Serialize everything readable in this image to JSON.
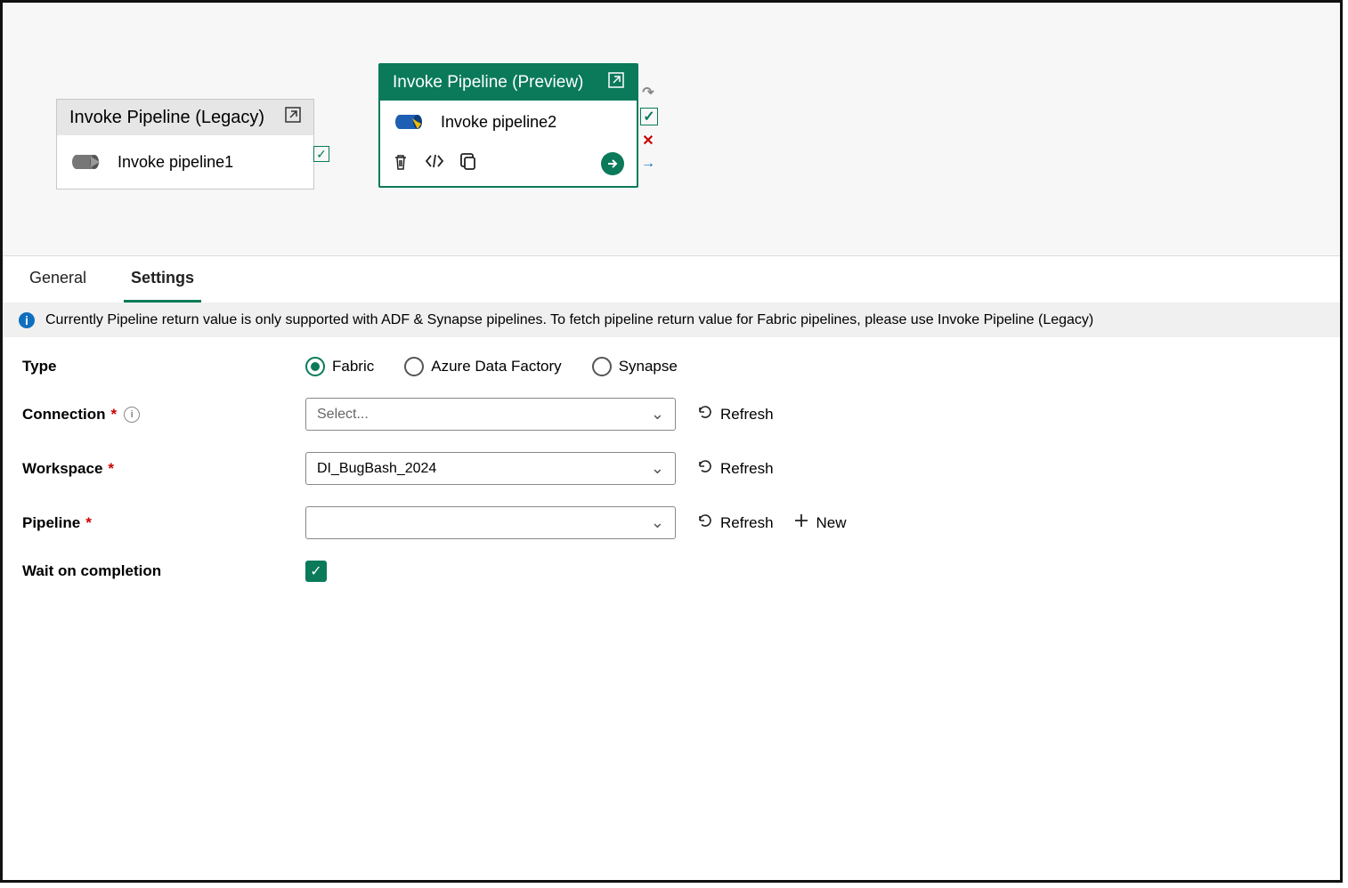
{
  "canvas": {
    "card1": {
      "title": "Invoke Pipeline (Legacy)",
      "name": "Invoke pipeline1"
    },
    "card2": {
      "title": "Invoke Pipeline (Preview)",
      "name": "Invoke pipeline2"
    }
  },
  "tabs": {
    "general": "General",
    "settings": "Settings"
  },
  "banner": "Currently Pipeline return value is only supported with ADF & Synapse pipelines. To fetch pipeline return value for Fabric pipelines, please use Invoke Pipeline (Legacy)",
  "form": {
    "type": {
      "label": "Type",
      "opts": [
        "Fabric",
        "Azure Data Factory",
        "Synapse"
      ],
      "selected": "Fabric"
    },
    "connection": {
      "label": "Connection",
      "placeholder": "Select...",
      "refresh": "Refresh"
    },
    "workspace": {
      "label": "Workspace",
      "value": "DI_BugBash_2024",
      "refresh": "Refresh"
    },
    "pipeline": {
      "label": "Pipeline",
      "value": "",
      "refresh": "Refresh",
      "new": "New"
    },
    "wait": {
      "label": "Wait on completion",
      "checked": true
    }
  }
}
